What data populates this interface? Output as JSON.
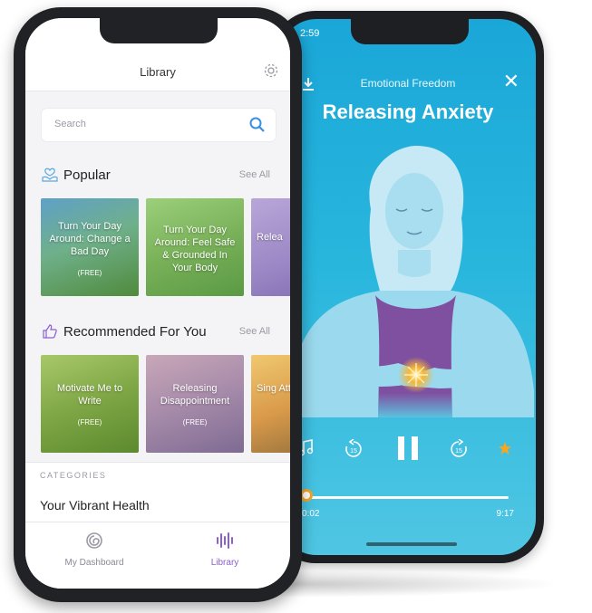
{
  "colors": {
    "accent": "#8a5fcf",
    "player_gradient_top": "#1aa7d8",
    "player_gradient_bottom": "#4fc6e3",
    "progress_knob": "#f5a623",
    "star": "#f5a623"
  },
  "player": {
    "status_time": "2:59",
    "subtitle": "Emotional Freedom",
    "title": "Releasing Anxiety",
    "elapsed": "0:02",
    "duration": "9:17",
    "progress_fraction": 0.004,
    "icons": [
      "download-icon",
      "close-icon",
      "music-note-icon",
      "rewind-15-icon",
      "pause-icon",
      "forward-15-icon",
      "star-icon"
    ]
  },
  "library": {
    "title": "Library",
    "search": {
      "placeholder": "Search"
    },
    "popular": {
      "title": "Popular",
      "see_all": "See All",
      "cards": [
        {
          "title": "Turn Your Day Around: Change a Bad Day",
          "badge": "(FREE)"
        },
        {
          "title": "Turn Your Day Around: Feel Safe & Grounded In Your Body",
          "badge": ""
        },
        {
          "title": "Relea",
          "badge": ""
        }
      ]
    },
    "recommended": {
      "title": "Recommended For You",
      "see_all": "See All",
      "cards": [
        {
          "title": "Motivate Me to Write",
          "badge": "(FREE)"
        },
        {
          "title": "Releasing Disappointment",
          "badge": "(FREE)"
        },
        {
          "title": "Sing Attra",
          "badge": ""
        }
      ]
    },
    "categories_label": "CATEGORIES",
    "category_first": "Your Vibrant Health",
    "tabs": [
      {
        "label": "My Dashboard",
        "active": false
      },
      {
        "label": "Library",
        "active": true
      }
    ]
  }
}
